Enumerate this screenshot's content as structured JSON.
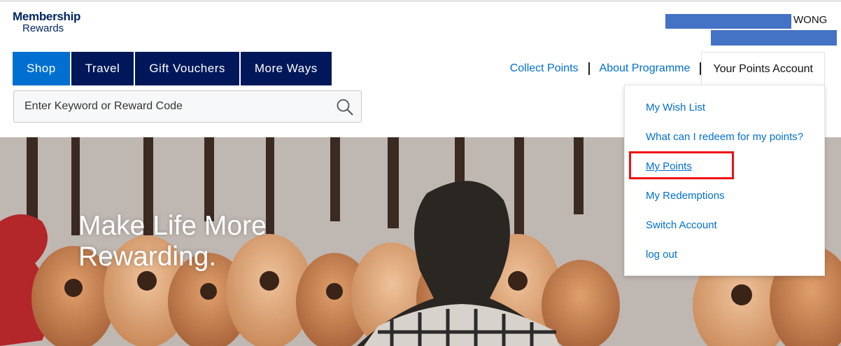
{
  "brand": {
    "line1": "Membership",
    "line2": "Rewards"
  },
  "user": {
    "surname": "WONG"
  },
  "nav": {
    "tabs": [
      {
        "label": "Shop",
        "active": true
      },
      {
        "label": "Travel"
      },
      {
        "label": "Gift Vouchers"
      },
      {
        "label": "More Ways"
      }
    ]
  },
  "search": {
    "placeholder": "Enter Keyword or Reward Code"
  },
  "header_links": {
    "collect": "Collect Points",
    "about": "About Programme",
    "account": "Your Points Account"
  },
  "account_menu": {
    "items": [
      {
        "label": "My Wish List"
      },
      {
        "label": "What can I redeem for my points?"
      },
      {
        "label": "My Points",
        "highlighted": true
      },
      {
        "label": "My Redemptions"
      },
      {
        "label": "Switch Account"
      },
      {
        "label": "log out"
      }
    ]
  },
  "hero": {
    "title_line1": "Make Life More",
    "title_line2": "Rewarding."
  },
  "colors": {
    "navy": "#00175a",
    "accent_blue": "#006fcf",
    "redaction": "#4472c4",
    "highlight_red": "#e11111"
  }
}
